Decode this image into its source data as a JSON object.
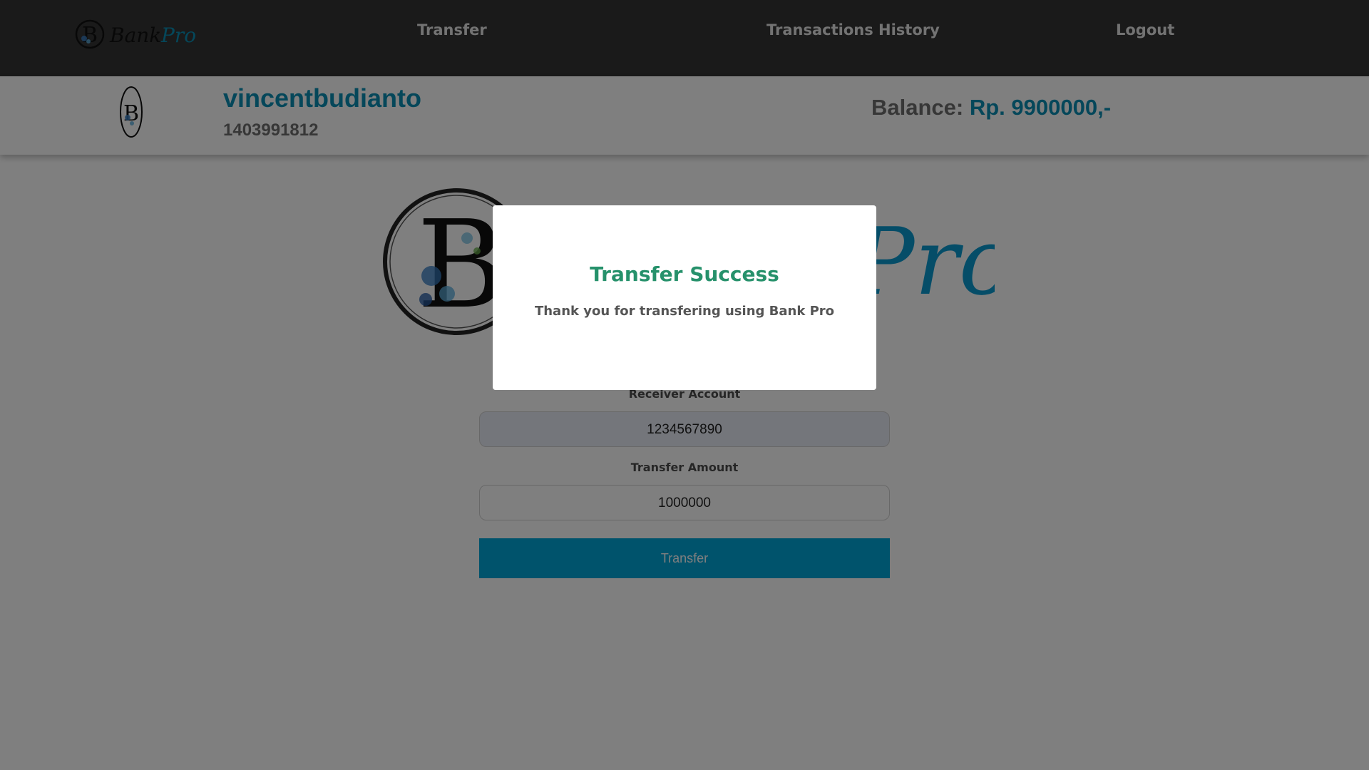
{
  "brand": {
    "logo_letter": "B",
    "logo_text_bank": "Bank",
    "logo_text_pro": "Pro",
    "accent_color": "#0a8fb4"
  },
  "nav": {
    "transfer": "Transfer",
    "history": "Transactions History",
    "logout": "Logout"
  },
  "profile": {
    "username": "vincentbudianto",
    "account_number": "1403991812",
    "balance_label": "Balance:",
    "balance_value": "Rp. 9900000,-"
  },
  "form": {
    "receiver_label": "Receiver Account",
    "receiver_value": "1234567890",
    "amount_label": "Transfer Amount",
    "amount_value": "1000000",
    "submit_label": "Transfer"
  },
  "modal": {
    "title": "Transfer Success",
    "message": "Thank you for transfering using Bank Pro"
  }
}
